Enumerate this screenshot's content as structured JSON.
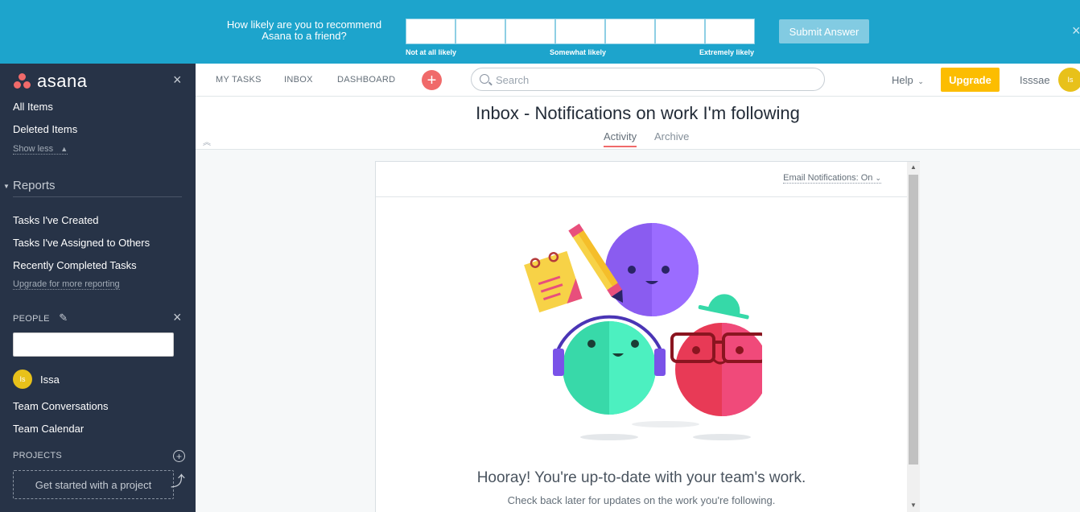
{
  "survey": {
    "question": "How likely are you to recommend Asana to a friend?",
    "label_low": "Not at all likely",
    "label_mid": "Somewhat likely",
    "label_high": "Extremely likely",
    "submit": "Submit Answer",
    "close": "×"
  },
  "sidebar": {
    "logo": "asana",
    "close": "×",
    "items": [
      "All Items",
      "Deleted Items"
    ],
    "show_less": "Show less",
    "reports_heading": "Reports",
    "reports": [
      "Tasks I've Created",
      "Tasks I've Assigned to Others",
      "Recently Completed Tasks"
    ],
    "upgrade_link": "Upgrade for more reporting",
    "people_heading": "PEOPLE",
    "people_close": "×",
    "person_initials": "Is",
    "person_name": "Issa",
    "team_conversations": "Team Conversations",
    "team_calendar": "Team Calendar",
    "projects_heading": "PROJECTS",
    "project_placeholder": "Get started with a project"
  },
  "topnav": {
    "links": [
      "MY TASKS",
      "INBOX",
      "DASHBOARD"
    ],
    "plus": "+",
    "search_placeholder": "Search",
    "help": "Help",
    "upgrade": "Upgrade",
    "user_name": "Isssae",
    "user_initials": "Is"
  },
  "page": {
    "title": "Inbox - Notifications on work I'm following",
    "tabs": [
      "Activity",
      "Archive"
    ],
    "email_notifications": "Email Notifications: On",
    "hooray": "Hooray! You're up-to-date with your team's work.",
    "check_back": "Check back later for updates on the work you're following."
  },
  "colors": {
    "banner": "#1da4cc",
    "sidebar": "#273347",
    "accent": "#f06a6a",
    "upgrade": "#fcbd01"
  }
}
